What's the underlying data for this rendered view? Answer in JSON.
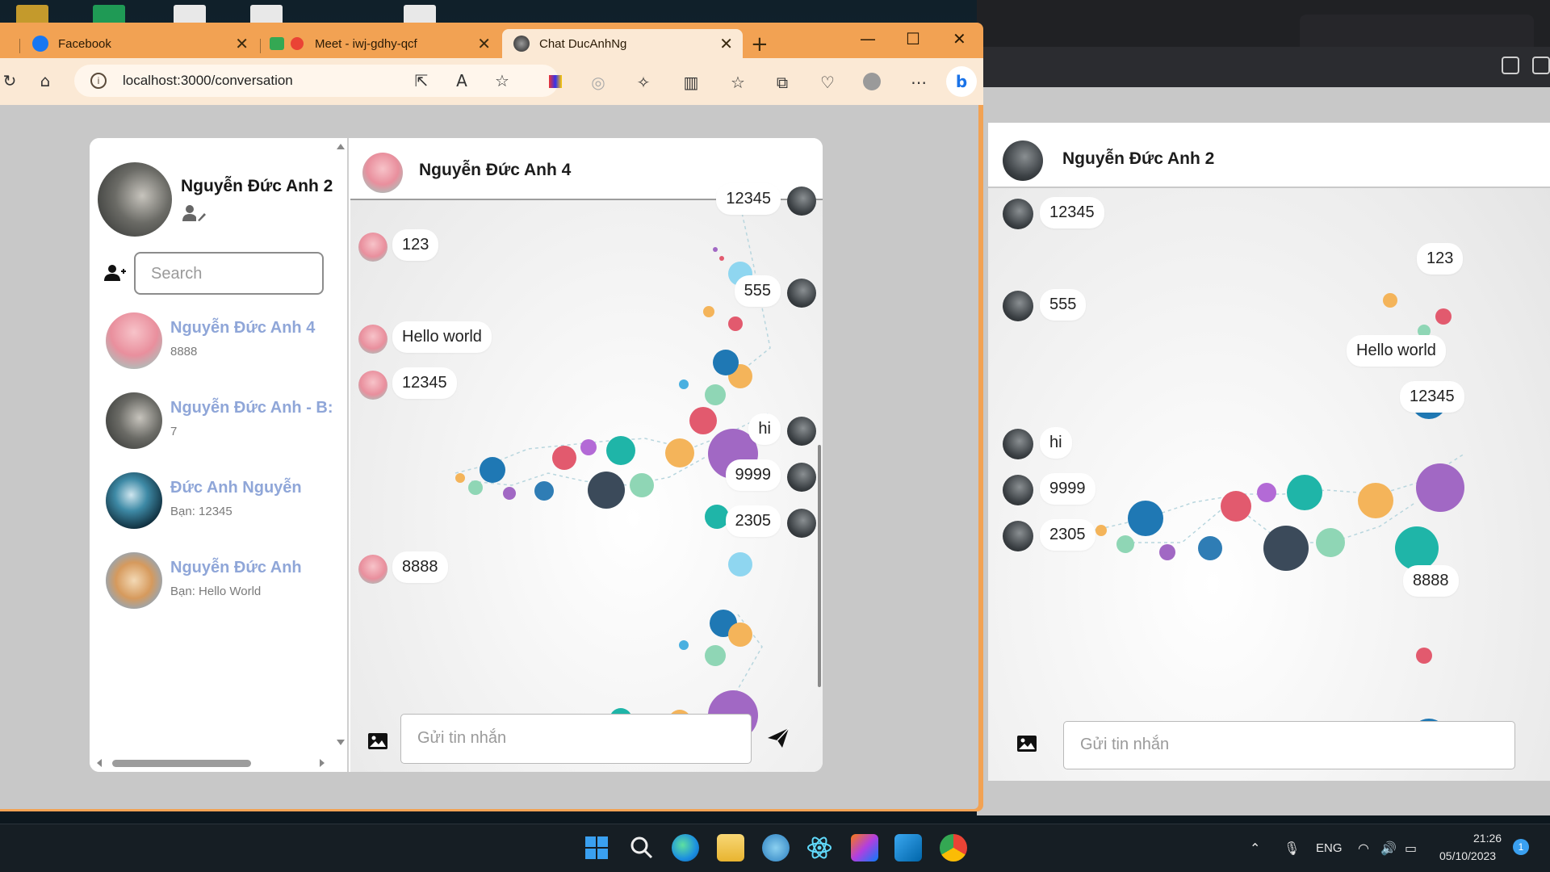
{
  "browser": {
    "tabs": [
      {
        "label": "Facebook",
        "favicon": "facebook-icon",
        "color": "#1877f2"
      },
      {
        "label": "Meet - iwj-gdhy-qcf",
        "favicon": "meet-icon",
        "color": "#ea4335"
      },
      {
        "label": "Chat DucAnhNg",
        "favicon": "chat-app-icon",
        "color": "#222222"
      }
    ],
    "new_tab": "+",
    "window_controls": {
      "minimize": "—",
      "maximize": "☐",
      "close": "✕"
    },
    "address": "localhost:3000/conversation",
    "accent_color": "#f2a253"
  },
  "app": {
    "me": {
      "name": "Nguyễn Đức Anh 2"
    },
    "search_placeholder": "Search",
    "conversations": [
      {
        "name": "Nguyễn Đức Anh 4",
        "last": "8888",
        "avatar": "pink-avatar"
      },
      {
        "name": "Nguyễn Đức Anh - B:",
        "last": "7",
        "avatar": "photo-avatar"
      },
      {
        "name": "Đức Anh Nguyễn",
        "last": "Bạn: 12345",
        "avatar": "black-cat-avatar"
      },
      {
        "name": "Nguyễn Đức Anh",
        "last": "Bạn: Hello World",
        "avatar": "cat-avatar"
      }
    ],
    "chat": {
      "partner_name": "Nguyễn Đức Anh 4",
      "messages": [
        {
          "side": "out",
          "text": "12345"
        },
        {
          "side": "in",
          "text": "123"
        },
        {
          "side": "out",
          "text": "555"
        },
        {
          "side": "in",
          "text": "Hello world"
        },
        {
          "side": "in",
          "text": "12345"
        },
        {
          "side": "out",
          "text": "hi"
        },
        {
          "side": "out",
          "text": "9999"
        },
        {
          "side": "out",
          "text": "2305"
        },
        {
          "side": "in",
          "text": "8888"
        }
      ],
      "input_placeholder": "Gửi tin nhắn"
    }
  },
  "second_window": {
    "partner_name": "Nguyễn Đức Anh 2",
    "messages": [
      {
        "side": "in",
        "text": "12345"
      },
      {
        "side": "out",
        "text": "123"
      },
      {
        "side": "in",
        "text": "555"
      },
      {
        "side": "out",
        "text": "Hello world"
      },
      {
        "side": "out",
        "text": "12345"
      },
      {
        "side": "in",
        "text": "hi"
      },
      {
        "side": "in",
        "text": "9999"
      },
      {
        "side": "in",
        "text": "2305"
      },
      {
        "side": "out",
        "text": "8888"
      }
    ],
    "input_placeholder": "Gửi tin nhắn"
  },
  "taskbar": {
    "language": "ENG",
    "time": "21:26",
    "date": "05/10/2023",
    "notification_count": "1"
  }
}
